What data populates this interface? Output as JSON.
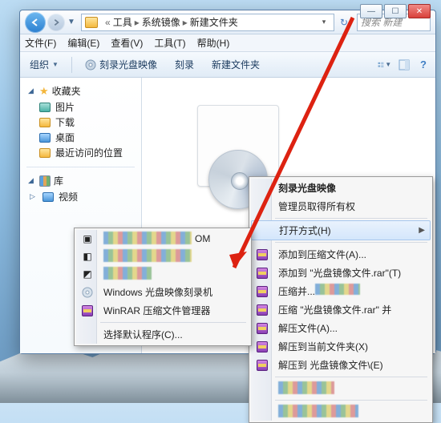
{
  "window_controls": {
    "min": "—",
    "max": "☐",
    "close": "✕"
  },
  "breadcrumb": {
    "root": "",
    "p1": "工具",
    "p2": "系统镜像",
    "p3": "新建文件夹"
  },
  "search_placeholder": "搜索 新建",
  "menubar": {
    "file": "文件(F)",
    "edit": "编辑(E)",
    "view": "查看(V)",
    "tools": "工具(T)",
    "help": "帮助(H)"
  },
  "toolbar": {
    "organize": "组织",
    "burn_image": "刻录光盘映像",
    "burn": "刻录",
    "new_folder": "新建文件夹"
  },
  "sidebar": {
    "favorites": "收藏夹",
    "fav_items": [
      "图片",
      "下载",
      "桌面",
      "最近访问的位置"
    ],
    "libraries": "库",
    "lib_items": [
      "视频"
    ]
  },
  "context_main": {
    "burn": "刻录光盘映像",
    "admin": "管理员取得所有权",
    "open_with": "打开方式(H)",
    "add_archive": "添加到压缩文件(A)...",
    "add_rar": "添加到 \"光盘镜像文件.rar\"(T)",
    "compress_and": "压缩并...",
    "compress_rar": "压缩 \"光盘镜像文件.rar\" 并",
    "extract": "解压文件(A)...",
    "extract_here": "解压到当前文件夹(X)",
    "extract_to": "解压到 光盘镜像文件\\(E)"
  },
  "context_sub": {
    "hidden1": "",
    "hidden2": "OM",
    "hidden3": "",
    "win_burner": "Windows 光盘映像刻录机",
    "winrar": "WinRAR 压缩文件管理器",
    "choose_default": "选择默认程序(C)..."
  }
}
